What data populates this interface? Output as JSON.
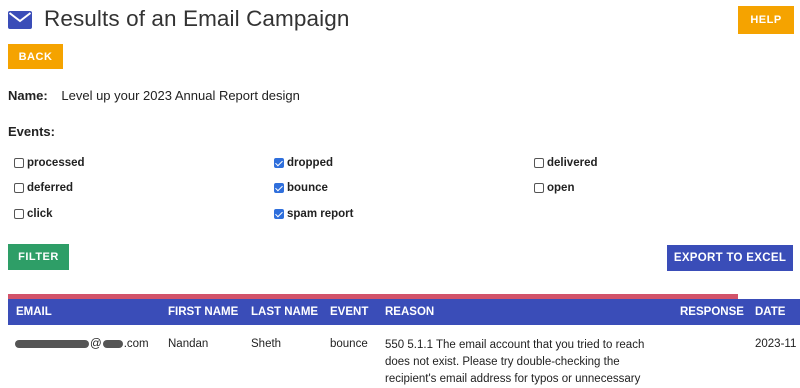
{
  "header": {
    "title": "Results of an Email Campaign",
    "title_icon": "envelope-icon",
    "help_label": "HELP",
    "back_label": "BACK"
  },
  "campaign": {
    "name_label": "Name:",
    "name_value": "Level up your 2023 Annual Report design"
  },
  "events": {
    "label": "Events:",
    "items": [
      {
        "label": "processed",
        "checked": false
      },
      {
        "label": "dropped",
        "checked": true
      },
      {
        "label": "delivered",
        "checked": false
      },
      {
        "label": "deferred",
        "checked": false
      },
      {
        "label": "bounce",
        "checked": true
      },
      {
        "label": "open",
        "checked": false
      },
      {
        "label": "click",
        "checked": false
      },
      {
        "label": "spam report",
        "checked": true
      }
    ]
  },
  "actions": {
    "filter_label": "FILTER",
    "export_label": "EXPORT TO EXCEL"
  },
  "colors": {
    "orange": "#f5a300",
    "green": "#2e9e67",
    "blue": "#3a4db8",
    "accent": "#d2536a"
  },
  "table": {
    "columns": [
      "EMAIL",
      "FIRST NAME",
      "LAST NAME",
      "EVENT",
      "REASON",
      "RESPONSE",
      "DATE"
    ],
    "rows": [
      {
        "email_suffix": "@",
        "email_domain_end": ".com",
        "first_name": "Nandan",
        "last_name": "Sheth",
        "event": "bounce",
        "reason": "550 5.1.1 The email account that you tried to reach does not exist. Please try double-checking the recipient's email address for typos or unnecessary",
        "response": "",
        "date": "2023-11"
      }
    ]
  }
}
